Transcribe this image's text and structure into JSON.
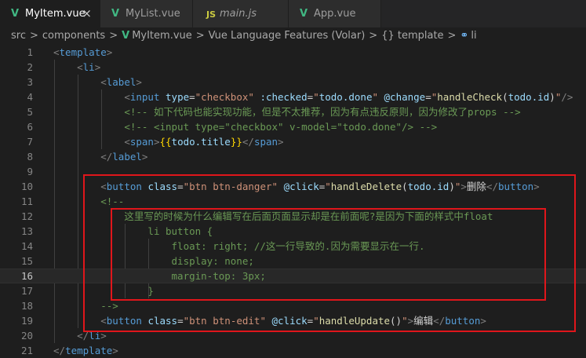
{
  "tabs": [
    {
      "label": "MyItem.vue",
      "icon": "vue-icon",
      "active": true,
      "close": "×"
    },
    {
      "label": "MyList.vue",
      "icon": "vue-icon",
      "active": false
    },
    {
      "label": "main.js",
      "icon": "js-icon",
      "active": false
    },
    {
      "label": "App.vue",
      "icon": "vue-icon",
      "active": false
    }
  ],
  "icons": {
    "vue": "V",
    "js": "JS"
  },
  "breadcrumb": {
    "items": [
      "src",
      "components",
      "MyItem.vue",
      "Vue Language Features (Volar)",
      "{} template",
      "li"
    ],
    "separator": ">"
  },
  "editor": {
    "current_line": 16,
    "lines": [
      {
        "n": "1",
        "tokens": [
          [
            "br",
            "<"
          ],
          [
            "tag",
            "template"
          ],
          [
            "br",
            ">"
          ]
        ]
      },
      {
        "n": "2",
        "tokens": [
          [
            "txt",
            "    "
          ],
          [
            "br",
            "<"
          ],
          [
            "tag",
            "li"
          ],
          [
            "br",
            ">"
          ]
        ]
      },
      {
        "n": "3",
        "tokens": [
          [
            "txt",
            "        "
          ],
          [
            "br",
            "<"
          ],
          [
            "tag",
            "label"
          ],
          [
            "br",
            ">"
          ]
        ]
      },
      {
        "n": "4",
        "tokens": [
          [
            "txt",
            "            "
          ],
          [
            "br",
            "<"
          ],
          [
            "tag",
            "input"
          ],
          [
            "txt",
            " "
          ],
          [
            "attr",
            "type"
          ],
          [
            "txt",
            "="
          ],
          [
            "str",
            "\"checkbox\""
          ],
          [
            "txt",
            " "
          ],
          [
            "attr",
            ":checked"
          ],
          [
            "txt",
            "="
          ],
          [
            "str",
            "\""
          ],
          [
            "attr",
            "todo.done"
          ],
          [
            "str",
            "\""
          ],
          [
            "txt",
            " "
          ],
          [
            "attr",
            "@change"
          ],
          [
            "txt",
            "="
          ],
          [
            "str",
            "\""
          ],
          [
            "fn",
            "handleCheck"
          ],
          [
            "txt",
            "("
          ],
          [
            "attr",
            "todo.id"
          ],
          [
            "txt",
            ")"
          ],
          [
            "str",
            "\""
          ],
          [
            "br",
            "/>"
          ]
        ]
      },
      {
        "n": "5",
        "tokens": [
          [
            "txt",
            "            "
          ],
          [
            "com",
            "<!-- 如下代码也能实现功能，但是不太推荐，因为有点违反原则，因为修改了props -->"
          ]
        ]
      },
      {
        "n": "6",
        "tokens": [
          [
            "txt",
            "            "
          ],
          [
            "com",
            "<!-- <input type=\"checkbox\" v-model=\"todo.done\"/> -->"
          ]
        ]
      },
      {
        "n": "7",
        "tokens": [
          [
            "txt",
            "            "
          ],
          [
            "br",
            "<"
          ],
          [
            "tag",
            "span"
          ],
          [
            "br",
            ">"
          ],
          [
            "mus",
            "{{"
          ],
          [
            "attr",
            "todo.title"
          ],
          [
            "mus",
            "}}"
          ],
          [
            "br",
            "</"
          ],
          [
            "tag",
            "span"
          ],
          [
            "br",
            ">"
          ]
        ]
      },
      {
        "n": "8",
        "tokens": [
          [
            "txt",
            "        "
          ],
          [
            "br",
            "</"
          ],
          [
            "tag",
            "label"
          ],
          [
            "br",
            ">"
          ]
        ]
      },
      {
        "n": "9",
        "tokens": []
      },
      {
        "n": "10",
        "tokens": [
          [
            "txt",
            "        "
          ],
          [
            "br",
            "<"
          ],
          [
            "tag",
            "button"
          ],
          [
            "txt",
            " "
          ],
          [
            "attr",
            "class"
          ],
          [
            "txt",
            "="
          ],
          [
            "str",
            "\"btn btn-danger\""
          ],
          [
            "txt",
            " "
          ],
          [
            "attr",
            "@click"
          ],
          [
            "txt",
            "="
          ],
          [
            "str",
            "\""
          ],
          [
            "fn",
            "handleDelete"
          ],
          [
            "txt",
            "("
          ],
          [
            "attr",
            "todo.id"
          ],
          [
            "txt",
            ")"
          ],
          [
            "str",
            "\""
          ],
          [
            "br",
            ">"
          ],
          [
            "txt",
            "删除"
          ],
          [
            "br",
            "</"
          ],
          [
            "tag",
            "button"
          ],
          [
            "br",
            ">"
          ]
        ]
      },
      {
        "n": "11",
        "tokens": [
          [
            "txt",
            "        "
          ],
          [
            "com",
            "<!--"
          ]
        ]
      },
      {
        "n": "12",
        "tokens": [
          [
            "txt",
            "            "
          ],
          [
            "com",
            "这里写的时候为什么编辑写在后面页面显示却是在前面呢?是因为下面的样式中float"
          ]
        ]
      },
      {
        "n": "13",
        "tokens": [
          [
            "txt",
            "                "
          ],
          [
            "com",
            "li button {"
          ]
        ]
      },
      {
        "n": "14",
        "tokens": [
          [
            "txt",
            "                    "
          ],
          [
            "com",
            "float: right; //这一行导致的.因为需要显示在一行."
          ]
        ]
      },
      {
        "n": "15",
        "tokens": [
          [
            "txt",
            "                    "
          ],
          [
            "com",
            "display: none;"
          ]
        ]
      },
      {
        "n": "16",
        "tokens": [
          [
            "txt",
            "                    "
          ],
          [
            "com",
            "margin-top: 3px;"
          ]
        ]
      },
      {
        "n": "17",
        "tokens": [
          [
            "txt",
            "                "
          ],
          [
            "com",
            "}"
          ]
        ]
      },
      {
        "n": "18",
        "tokens": [
          [
            "txt",
            "        "
          ],
          [
            "com",
            "-->"
          ]
        ]
      },
      {
        "n": "19",
        "tokens": [
          [
            "txt",
            "        "
          ],
          [
            "br",
            "<"
          ],
          [
            "tag",
            "button"
          ],
          [
            "txt",
            " "
          ],
          [
            "attr",
            "class"
          ],
          [
            "txt",
            "="
          ],
          [
            "str",
            "\"btn btn-edit\""
          ],
          [
            "txt",
            " "
          ],
          [
            "attr",
            "@click"
          ],
          [
            "txt",
            "="
          ],
          [
            "str",
            "\""
          ],
          [
            "fn",
            "handleUpdate"
          ],
          [
            "txt",
            "()"
          ],
          [
            "str",
            "\""
          ],
          [
            "br",
            ">"
          ],
          [
            "txt",
            "编辑"
          ],
          [
            "br",
            "</"
          ],
          [
            "tag",
            "button"
          ],
          [
            "br",
            ">"
          ]
        ]
      },
      {
        "n": "20",
        "tokens": [
          [
            "txt",
            "    "
          ],
          [
            "br",
            "</"
          ],
          [
            "tag",
            "li"
          ],
          [
            "br",
            ">"
          ]
        ]
      },
      {
        "n": "21",
        "tokens": [
          [
            "br",
            "</"
          ],
          [
            "tag",
            "template"
          ],
          [
            "br",
            ">"
          ]
        ]
      }
    ]
  },
  "colors": {
    "highlight_box": "#e0161b",
    "vue": "#41b883",
    "js": "#cbcb41"
  }
}
